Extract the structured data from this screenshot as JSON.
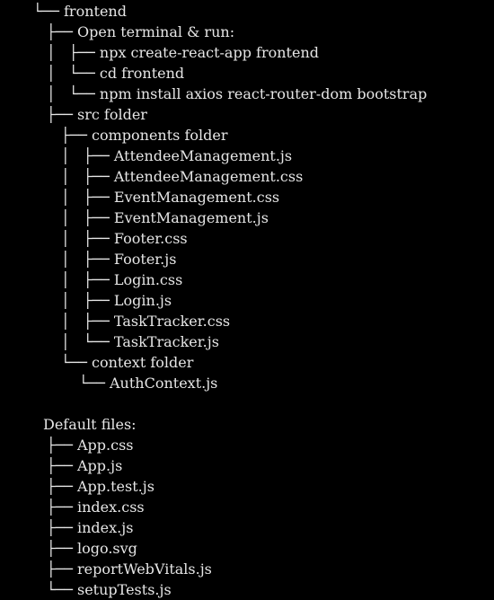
{
  "tree": [
    {
      "prefix": "└──",
      "name": "frontend"
    },
    {
      "prefix": "├──",
      "name": "Open terminal & run:"
    },
    {
      "prefix": "│   ├──",
      "name": "npx create-react-app frontend"
    },
    {
      "prefix": "│   └──",
      "name": "cd frontend"
    },
    {
      "prefix": "│   └──",
      "name": "npm install axios react-router-dom bootstrap"
    },
    {
      "prefix": "├──",
      "name": "src folder"
    },
    {
      "prefix": "├──",
      "name": "components folder"
    },
    {
      "prefix": "│   ├──",
      "name": "AttendeeManagement.js"
    },
    {
      "prefix": "│   ├──",
      "name": "AttendeeManagement.css"
    },
    {
      "prefix": "│   ├──",
      "name": "EventManagement.css"
    },
    {
      "prefix": "│   ├──",
      "name": "EventManagement.js"
    },
    {
      "prefix": "│   ├──",
      "name": "Footer.css"
    },
    {
      "prefix": "│   ├──",
      "name": "Footer.js"
    },
    {
      "prefix": "│   ├──",
      "name": "Login.css"
    },
    {
      "prefix": "│   ├──",
      "name": "Login.js"
    },
    {
      "prefix": "│   ├──",
      "name": "TaskTracker.css"
    },
    {
      "prefix": "│   └──",
      "name": "TaskTracker.js"
    },
    {
      "prefix": "└──",
      "name": "context folder"
    },
    {
      "prefix": "└──",
      "name": "AuthContext.js"
    },
    {
      "prefix": "",
      "name": ""
    },
    {
      "prefix": "",
      "name": "Default files:"
    },
    {
      "prefix": "├──",
      "name": "App.css"
    },
    {
      "prefix": "├──",
      "name": "App.js"
    },
    {
      "prefix": "├──",
      "name": "App.test.js"
    },
    {
      "prefix": "├──",
      "name": "index.css"
    },
    {
      "prefix": "├──",
      "name": "index.js"
    },
    {
      "prefix": "├──",
      "name": "logo.svg"
    },
    {
      "prefix": "├──",
      "name": "reportWebVitals.js"
    },
    {
      "prefix": "└──",
      "name": "setupTests.js"
    }
  ]
}
